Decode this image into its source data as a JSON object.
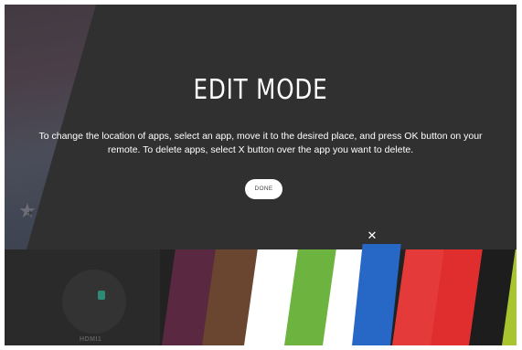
{
  "edit_mode": {
    "title": "EDIT MODE",
    "instructions": "To change the location of apps, select an app, move it to the desired place, and press OK button on your remote. To delete apps, select X button over the app you want to delete.",
    "done_label": "DONE",
    "delete_glyph": "✕"
  },
  "app_bar": {
    "hdmi_label": "HDMI1",
    "tiles": [
      {
        "color": "#5a2840"
      },
      {
        "color": "#6a4530"
      },
      {
        "color": "#ffffff"
      },
      {
        "color": "#6db33f"
      },
      {
        "color": "#ffffff"
      },
      {
        "color": "#2767c6",
        "selected": true
      },
      {
        "color": "#e53a3a"
      },
      {
        "color": "#e02e2e"
      },
      {
        "color": "#1d1d1d"
      },
      {
        "color": "#a8c530"
      }
    ]
  },
  "icons": {
    "favorite": "star-icon",
    "delete": "close-icon",
    "input": "hdmi-icon"
  },
  "colors": {
    "overlay": "#373737",
    "accent_selected": "#2767c6"
  }
}
